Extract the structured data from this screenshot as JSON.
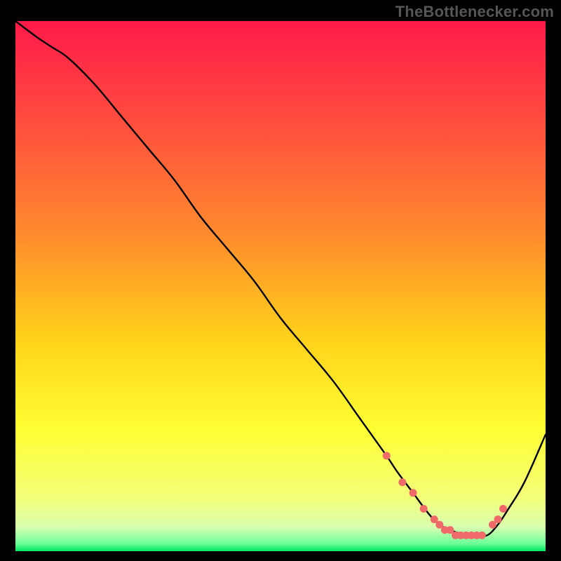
{
  "attribution": "TheBottlenecker.com",
  "colors": {
    "curve": "#000000",
    "marker_fill": "#f06a6a",
    "marker_stroke": "#c94a4a",
    "gradient_stops": [
      {
        "offset": 0.0,
        "color": "#ff1a4a"
      },
      {
        "offset": 0.18,
        "color": "#ff4a3f"
      },
      {
        "offset": 0.4,
        "color": "#ff8a2e"
      },
      {
        "offset": 0.6,
        "color": "#ffd21a"
      },
      {
        "offset": 0.77,
        "color": "#ffff33"
      },
      {
        "offset": 0.9,
        "color": "#f4ff7a"
      },
      {
        "offset": 0.955,
        "color": "#d9ffb0"
      },
      {
        "offset": 0.985,
        "color": "#6fff9a"
      },
      {
        "offset": 1.0,
        "color": "#00e864"
      }
    ]
  },
  "chart_data": {
    "type": "line",
    "title": "",
    "xlabel": "",
    "ylabel": "",
    "xlim": [
      0,
      100
    ],
    "ylim": [
      0,
      100
    ],
    "legend": false,
    "grid": false,
    "series": [
      {
        "name": "bottleneck-curve",
        "x": [
          0,
          4,
          7,
          10,
          15,
          20,
          25,
          30,
          35,
          40,
          45,
          50,
          55,
          60,
          65,
          70,
          72,
          75,
          78,
          80,
          82,
          85,
          87,
          89,
          91,
          93,
          96,
          100
        ],
        "y": [
          100,
          97,
          95,
          93,
          88,
          82,
          76,
          70,
          63,
          57,
          51,
          44,
          38,
          32,
          25,
          18,
          15,
          11,
          7,
          5,
          4,
          3,
          3,
          3,
          5,
          8,
          13,
          22
        ]
      }
    ],
    "markers": {
      "name": "highlight-points",
      "x": [
        70,
        73,
        75,
        77,
        79,
        80,
        81,
        82,
        83,
        84,
        85,
        86,
        87,
        88,
        90,
        91,
        92
      ],
      "y": [
        18,
        13,
        11,
        8,
        6,
        5,
        4,
        4,
        3,
        3,
        3,
        3,
        3,
        3,
        5,
        6,
        8
      ]
    }
  }
}
